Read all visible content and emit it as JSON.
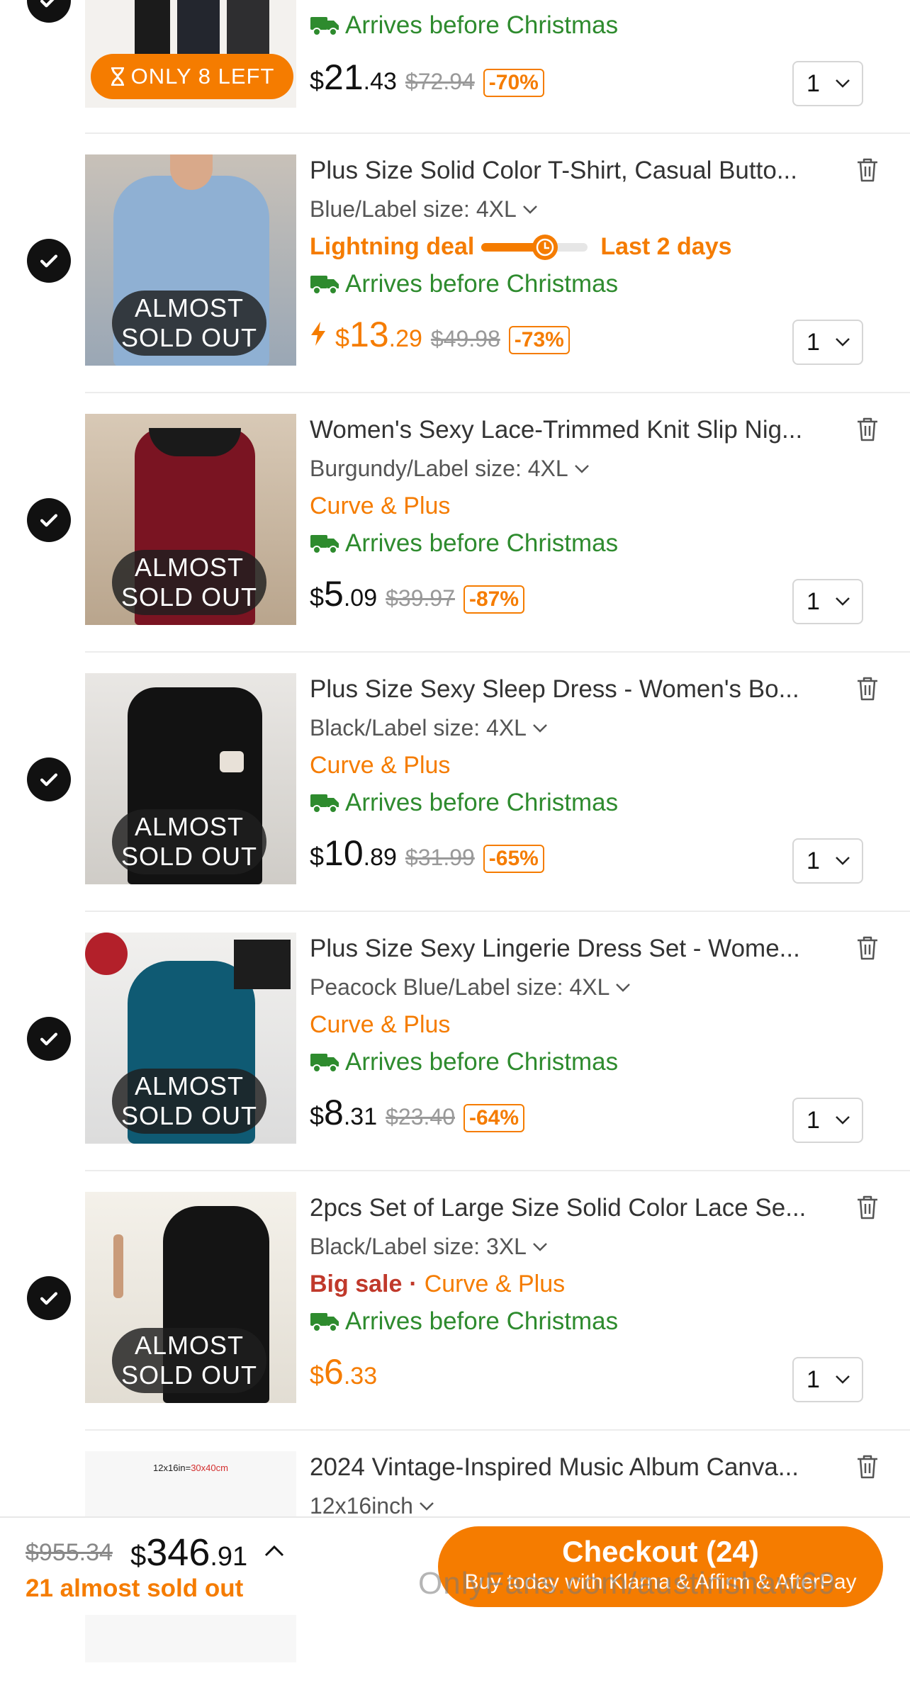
{
  "items": [
    {
      "title": "",
      "variant": "",
      "tags": [],
      "arrival": "Arrives before Christmas",
      "price": {
        "currency": "$",
        "integer": "21",
        "decimal": ".43"
      },
      "was_price": "$72.94",
      "discount": "-70%",
      "quantity": "1",
      "stock_badge": "ONLY 8 LEFT",
      "selected": true
    },
    {
      "title": "Plus Size Solid Color T-Shirt, Casual Butto...",
      "variant": "Blue/Label size: 4XL",
      "lightning_deal": {
        "label": "Lightning deal",
        "remaining": "Last 2 days",
        "progress": 0.6
      },
      "arrival": "Arrives before Christmas",
      "price": {
        "currency": "$",
        "integer": "13",
        "decimal": ".29"
      },
      "was_price": "$49.98",
      "discount": "-73%",
      "quantity": "1",
      "stock_badge": [
        "ALMOST",
        "SOLD OUT"
      ],
      "selected": true
    },
    {
      "title": "Women's Sexy Lace-Trimmed Knit Slip Nig...",
      "variant": "Burgundy/Label size: 4XL",
      "tag": "Curve & Plus",
      "arrival": "Arrives before Christmas",
      "price": {
        "currency": "$",
        "integer": "5",
        "decimal": ".09"
      },
      "was_price": "$39.97",
      "discount": "-87%",
      "quantity": "1",
      "stock_badge": [
        "ALMOST",
        "SOLD OUT"
      ],
      "selected": true
    },
    {
      "title": "Plus Size Sexy Sleep Dress - Women's Bo...",
      "variant": "Black/Label size: 4XL",
      "tag": "Curve & Plus",
      "arrival": "Arrives before Christmas",
      "price": {
        "currency": "$",
        "integer": "10",
        "decimal": ".89"
      },
      "was_price": "$31.99",
      "discount": "-65%",
      "quantity": "1",
      "stock_badge": [
        "ALMOST",
        "SOLD OUT"
      ],
      "selected": true
    },
    {
      "title": "Plus Size Sexy Lingerie Dress Set - Wome...",
      "variant": "Peacock Blue/Label size: 4XL",
      "tag": "Curve & Plus",
      "arrival": "Arrives before Christmas",
      "price": {
        "currency": "$",
        "integer": "8",
        "decimal": ".31"
      },
      "was_price": "$23.40",
      "discount": "-64%",
      "quantity": "1",
      "stock_badge": [
        "ALMOST",
        "SOLD OUT"
      ],
      "selected": true
    },
    {
      "title": "2pcs Set of Large Size Solid Color Lace Se...",
      "variant": "Black/Label size: 3XL",
      "sale_tag": "Big sale",
      "separator": "·",
      "tag": "Curve & Plus",
      "arrival": "Arrives before Christmas",
      "price": {
        "currency": "$",
        "integer": "6",
        "decimal": ".33"
      },
      "quantity": "1",
      "stock_badge": [
        "ALMOST",
        "SOLD OUT"
      ],
      "selected": true
    },
    {
      "title": "2024 Vintage-Inspired Music Album Canva...",
      "variant": "12x16inch",
      "thumb_label": {
        "size": "12x16in=",
        "metric": "30x40cm"
      }
    }
  ],
  "footer": {
    "was_total": "$955.34",
    "total": {
      "currency": "$",
      "integer": "346",
      "decimal": ".91"
    },
    "almost_sold_out": "21 almost sold out",
    "checkout_label": "Checkout (24)",
    "checkout_sub": "Buy today with Klarna & Affirm & AfterPay"
  },
  "watermark": "OnlyFans.com/austinshaw69",
  "colors": {
    "accent": "#f57c00",
    "arrival_green": "#2e8b2e",
    "sale_red": "#c0392b",
    "text": "#222222"
  }
}
